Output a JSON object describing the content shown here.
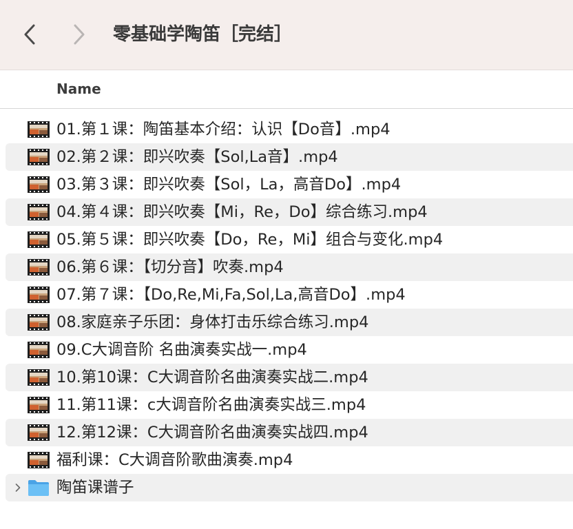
{
  "window": {
    "title": "零基础学陶笛［完结］",
    "back_icon": "chevron-left-icon",
    "forward_icon": "chevron-right-icon"
  },
  "columns": {
    "name_label": "Name"
  },
  "files": [
    {
      "name": "01.第１课：陶笛基本介绍：认识【Do音】.mp4",
      "kind": "video"
    },
    {
      "name": "02.第２课：即兴吹奏【Sol,La音】.mp4",
      "kind": "video"
    },
    {
      "name": "03.第３课：即兴吹奏【Sol，La，高音Do】.mp4",
      "kind": "video"
    },
    {
      "name": "04.第４课：即兴吹奏【Mi，Re，Do】综合练习.mp4",
      "kind": "video"
    },
    {
      "name": "05.第５课：即兴吹奏【Do，Re，Mi】组合与变化.mp4",
      "kind": "video"
    },
    {
      "name": "06.第６课：【切分音】吹奏.mp4",
      "kind": "video"
    },
    {
      "name": "07.第７课：【Do,Re,Mi,Fa,Sol,La,高音Do】.mp4",
      "kind": "video"
    },
    {
      "name": "08.家庭亲子乐团：身体打击乐综合练习.mp4",
      "kind": "video"
    },
    {
      "name": "09.C大调音阶 名曲演奏实战一.mp4",
      "kind": "video"
    },
    {
      "name": "10.第10课：C大调音阶名曲演奏实战二.mp4",
      "kind": "video"
    },
    {
      "name": "11.第11课：c大调音阶名曲演奏实战三.mp4",
      "kind": "video"
    },
    {
      "name": "12.第12课：C大调音阶名曲演奏实战四.mp4",
      "kind": "video"
    },
    {
      "name": "福利课：C大调音阶歌曲演奏.mp4",
      "kind": "video"
    },
    {
      "name": "陶笛课谱子",
      "kind": "folder"
    }
  ],
  "colors": {
    "titlebar_bg": "#f5eeec",
    "row_alt_bg": "#f0f0f0",
    "folder_blue": "#5cb3f0"
  }
}
